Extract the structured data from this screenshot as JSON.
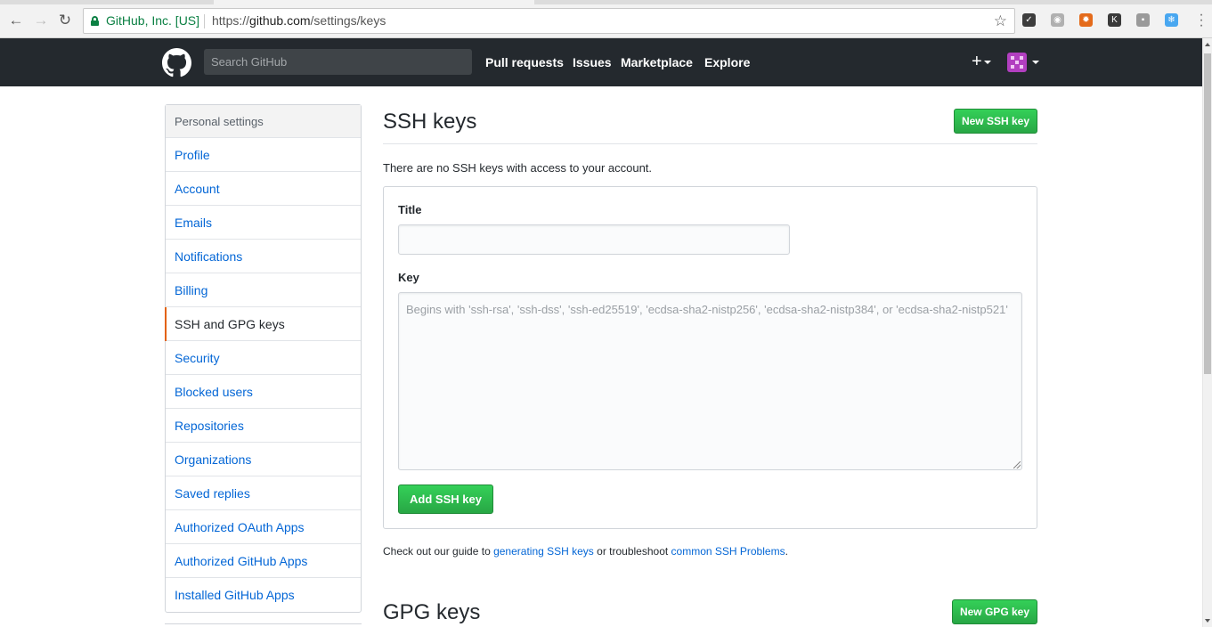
{
  "browser": {
    "org_label": "GitHub, Inc. [US]",
    "url_prefix": "https://",
    "url_host": "github.com",
    "url_path": "/settings/keys",
    "extensions": [
      {
        "name": "checkmark-extension-icon",
        "color": "#3d3d3d",
        "glyph": "✓"
      },
      {
        "name": "grammarly-extension-icon",
        "color": "#b0b0b0",
        "glyph": "◉"
      },
      {
        "name": "gear-extension-icon",
        "color": "#e46b1b",
        "glyph": "✹"
      },
      {
        "name": "k-extension-icon",
        "color": "#3a3a3a",
        "glyph": "K"
      },
      {
        "name": "note-extension-icon",
        "color": "#9a9a9a",
        "glyph": "▪"
      },
      {
        "name": "snowflake-extension-icon",
        "color": "#49a7f0",
        "glyph": "❄"
      }
    ]
  },
  "header": {
    "search_placeholder": "Search GitHub",
    "nav": [
      "Pull requests",
      "Issues",
      "Marketplace",
      "Explore"
    ],
    "plus_label": "+"
  },
  "sidebar": {
    "heading": "Personal settings",
    "items": [
      {
        "label": "Profile"
      },
      {
        "label": "Account"
      },
      {
        "label": "Emails"
      },
      {
        "label": "Notifications"
      },
      {
        "label": "Billing"
      },
      {
        "label": "SSH and GPG keys",
        "selected": true
      },
      {
        "label": "Security"
      },
      {
        "label": "Blocked users"
      },
      {
        "label": "Repositories"
      },
      {
        "label": "Organizations"
      },
      {
        "label": "Saved replies"
      },
      {
        "label": "Authorized OAuth Apps"
      },
      {
        "label": "Authorized GitHub Apps"
      },
      {
        "label": "Installed GitHub Apps"
      }
    ]
  },
  "ssh": {
    "title": "SSH keys",
    "new_button": "New SSH key",
    "empty_note": "There are no SSH keys with access to your account.",
    "title_label": "Title",
    "title_value": "",
    "key_label": "Key",
    "key_placeholder": "Begins with 'ssh-rsa', 'ssh-dss', 'ssh-ed25519', 'ecdsa-sha2-nistp256', 'ecdsa-sha2-nistp384', or 'ecdsa-sha2-nistp521'",
    "add_button": "Add SSH key",
    "guide_prefix": "Check out our guide to ",
    "guide_link": "generating SSH keys",
    "guide_middle": " or troubleshoot ",
    "problems_link": "common SSH Problems",
    "guide_suffix": "."
  },
  "gpg": {
    "title": "GPG keys",
    "new_button": "New GPG key"
  },
  "colors": {
    "header_bg": "#24292e",
    "link": "#0366d6",
    "green": "#28a745",
    "selected_marker": "#e36209"
  }
}
